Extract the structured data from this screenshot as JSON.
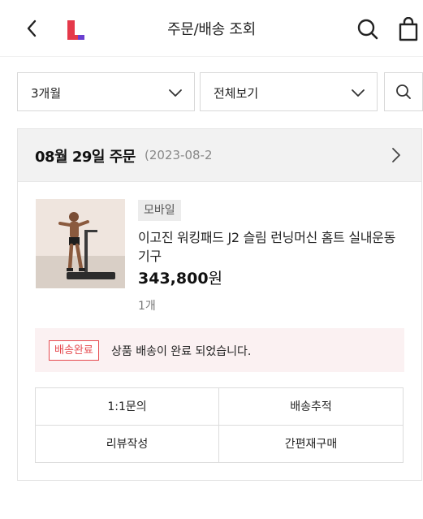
{
  "header": {
    "title": "주문/배송 조회",
    "back_icon": "chevron-left-icon",
    "logo_icon": "l-logo-icon",
    "search_icon": "search-icon",
    "cart_icon": "shopping-bag-icon",
    "brand_colors": [
      "#e5394a",
      "#6a3fd0"
    ]
  },
  "filters": {
    "period": "3개월",
    "type": "전체보기",
    "chevron_icon": "chevron-down-icon",
    "search_icon": "search-icon"
  },
  "order": {
    "date": "08월 29일 주문",
    "order_number": "(2023-08-2",
    "arrow_icon": "chevron-right-icon",
    "product": {
      "channel_badge": "모바일",
      "name": "이고진 워킹패드 J2 슬림 런닝머신 홈트 실내운동 기구",
      "price_value": "343,800",
      "price_unit": "원",
      "quantity": "1개"
    },
    "status": {
      "badge": "배송완료",
      "message": "상품 배송이 완료 되었습니다.",
      "accent_color": "#e5494e"
    },
    "actions": [
      "1:1문의",
      "배송추적",
      "리뷰작성",
      "간편재구매"
    ]
  }
}
